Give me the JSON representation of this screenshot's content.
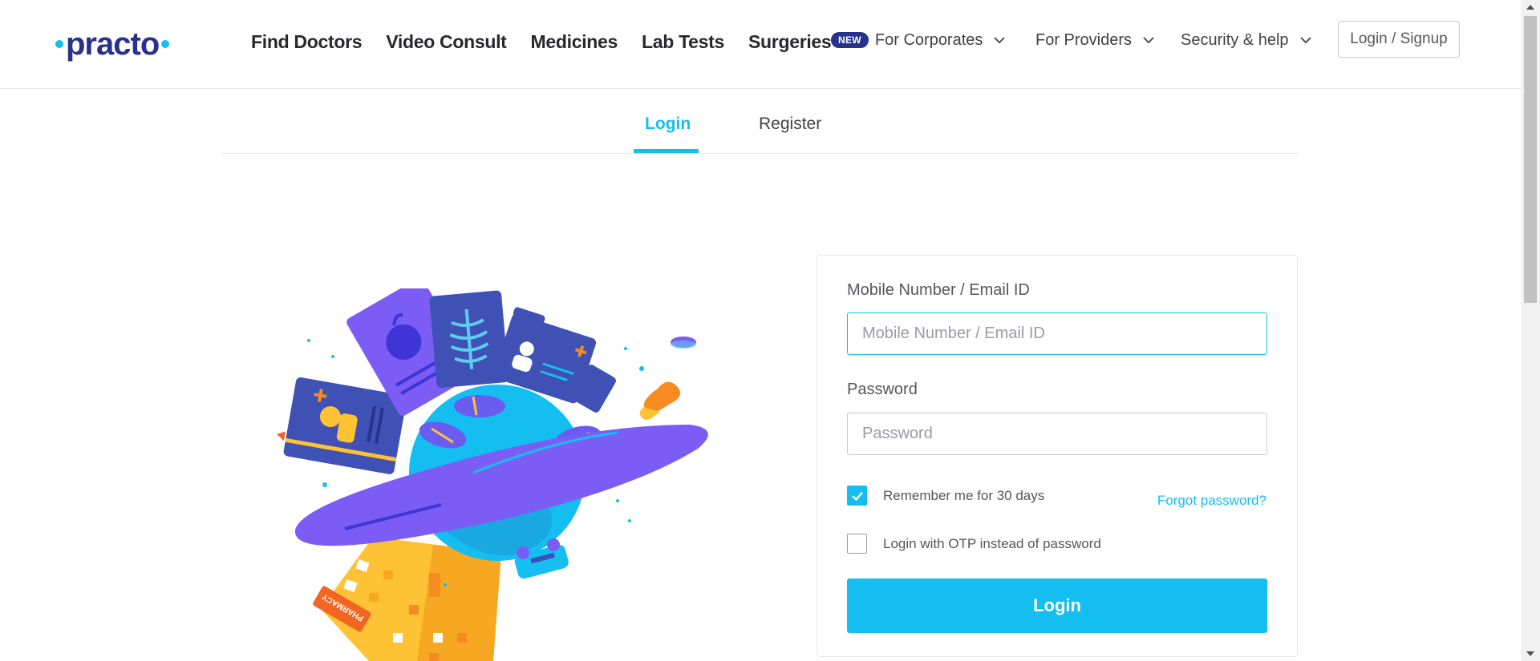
{
  "brand": {
    "name": "practo",
    "accent": "#14bef0",
    "primary": "#28328c"
  },
  "nav": {
    "main": [
      "Find Doctors",
      "Video Consult",
      "Medicines",
      "Lab Tests",
      "Surgeries"
    ],
    "new_badge": "NEW",
    "corporates": "For Corporates",
    "providers": "For Providers",
    "security": "Security & help",
    "login_signup": "Login / Signup"
  },
  "tabs": {
    "login": "Login",
    "register": "Register"
  },
  "form": {
    "mobile_label": "Mobile Number / Email ID",
    "mobile_placeholder": "Mobile Number / Email ID",
    "mobile_value": "",
    "password_label": "Password",
    "password_placeholder": "Password",
    "remember_label": "Remember me for 30 days",
    "remember_checked": true,
    "forgot_link": "Forgot password?",
    "otp_label": "Login with OTP instead of password",
    "otp_checked": false,
    "submit_label": "Login"
  },
  "illustration": {
    "pharmacy_label": "PHARMACY"
  },
  "icons": {
    "chevron": "chevron-down-icon",
    "check": "check-icon",
    "scroll_up": "arrow-up-icon",
    "scroll_down": "arrow-down-icon"
  }
}
